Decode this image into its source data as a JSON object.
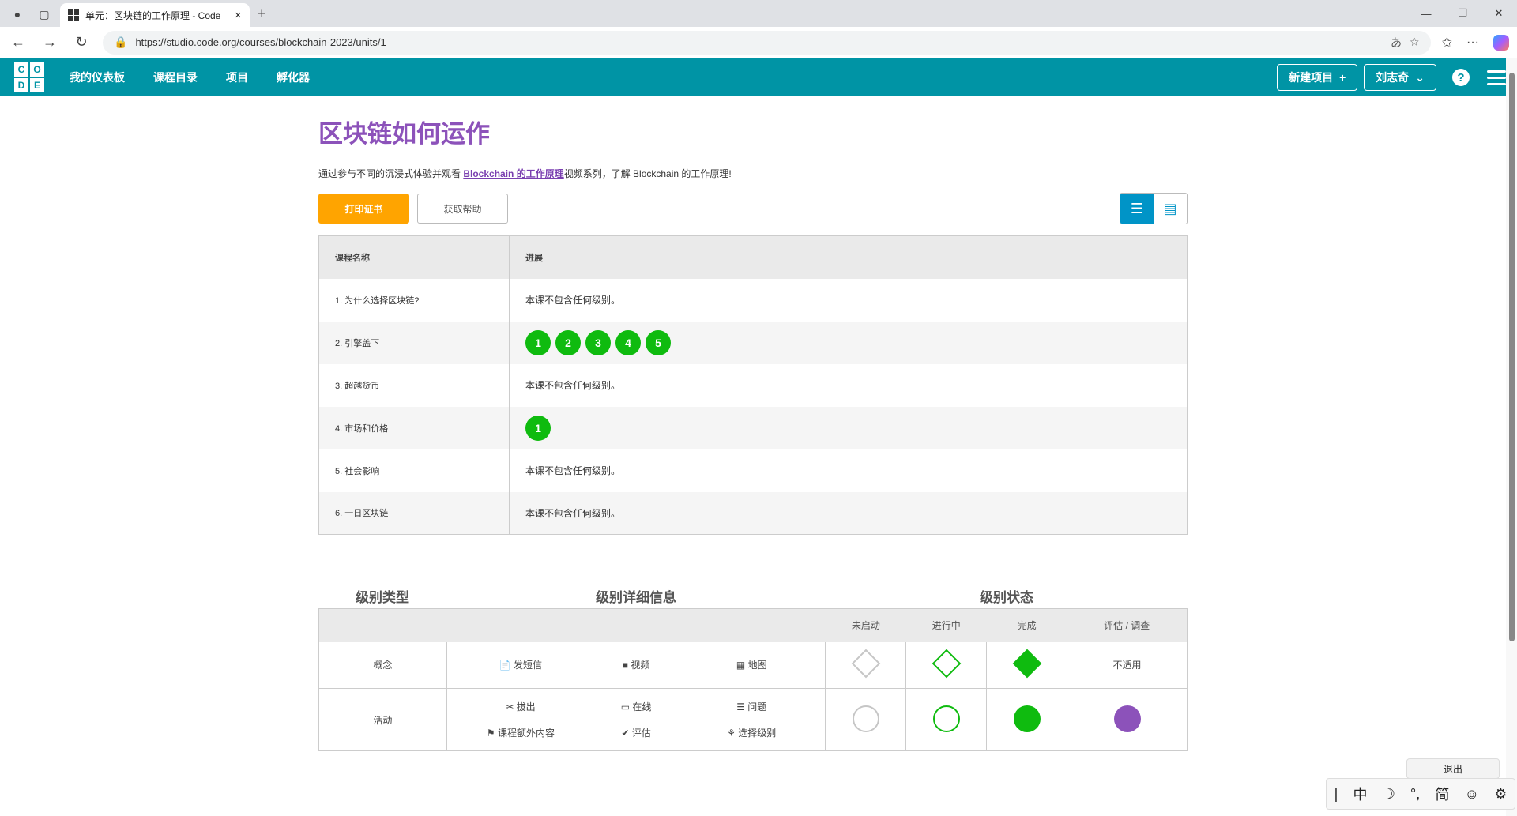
{
  "browser": {
    "tab_title": "单元：区块链的工作原理 - Code",
    "url": "https://studio.code.org/courses/blockchain-2023/units/1",
    "new_tab": "+",
    "win_min": "—",
    "win_restore": "❐",
    "win_close": "✕",
    "tab_close": "✕"
  },
  "header": {
    "logo_letters": [
      "C",
      "O",
      "D",
      "E"
    ],
    "nav": [
      "我的仪表板",
      "课程目录",
      "项目",
      "孵化器"
    ],
    "new_project": "新建项目",
    "user": "刘志奇",
    "help": "?"
  },
  "page": {
    "title": "区块链如何运作",
    "desc_before": "通过参与不同的沉浸式体验并观看 ",
    "desc_link": "Blockchain 的工作原理",
    "desc_after": "视频系列，了解 Blockchain 的工作原理!",
    "print_btn": "打印证书",
    "help_btn": "获取帮助"
  },
  "progress_table": {
    "headers": [
      "课程名称",
      "进展"
    ],
    "rows": [
      {
        "name": "1. 为什么选择区块链?",
        "text": "本课不包含任何级别。",
        "levels": []
      },
      {
        "name": "2. 引擎盖下",
        "text": "",
        "levels": [
          "1",
          "2",
          "3",
          "4",
          "5"
        ]
      },
      {
        "name": "3. 超越货币",
        "text": "本课不包含任何级别。",
        "levels": []
      },
      {
        "name": "4. 市场和价格",
        "text": "",
        "levels": [
          "1"
        ]
      },
      {
        "name": "5. 社会影响",
        "text": "本课不包含任何级别。",
        "levels": []
      },
      {
        "name": "6. 一日区块链",
        "text": "本课不包含任何级别。",
        "levels": []
      }
    ]
  },
  "legend": {
    "head_type": "级别类型",
    "head_details": "级别详细信息",
    "head_status": "级别状态",
    "status_cols": [
      "未启动",
      "进行中",
      "完成",
      "评估 / 调查"
    ],
    "concept": "概念",
    "activity": "活动",
    "concept_items": [
      {
        "icon": "📄",
        "label": "发短信"
      },
      {
        "icon": "■",
        "label": "视频"
      },
      {
        "icon": "▦",
        "label": "地图"
      }
    ],
    "activity_items": [
      {
        "icon": "✂",
        "label": "拔出"
      },
      {
        "icon": "▭",
        "label": "在线"
      },
      {
        "icon": "☰",
        "label": "问题"
      },
      {
        "icon": "⚑",
        "label": "课程额外内容"
      },
      {
        "icon": "✔",
        "label": "评估"
      },
      {
        "icon": "⚘",
        "label": "选择级别"
      }
    ],
    "na": "不适用",
    "colors": {
      "green": "#0fbb0f",
      "purple": "#8c52ba",
      "gray": "#c6c6c6"
    }
  },
  "overlay": {
    "logout": "退出",
    "ime": [
      "|",
      "中",
      "☽",
      "°,",
      "简",
      "☺",
      "⚙"
    ]
  }
}
